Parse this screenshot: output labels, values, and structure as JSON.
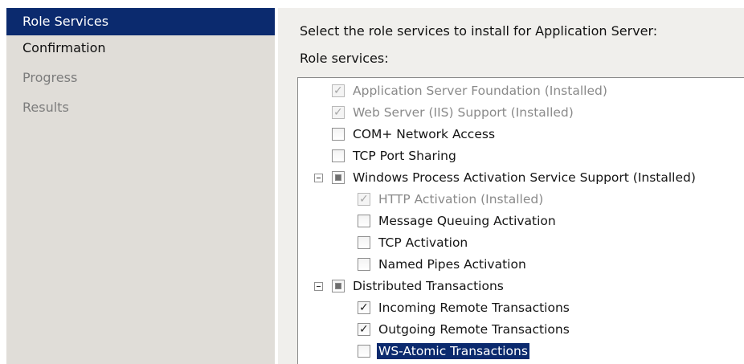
{
  "sidebar": {
    "steps": [
      {
        "label": "Role Services",
        "state": "active"
      },
      {
        "label": "Confirmation",
        "state": "normal"
      },
      {
        "label": "Progress",
        "state": "pending"
      },
      {
        "label": "Results",
        "state": "pending"
      }
    ]
  },
  "main": {
    "instruction": "Select the role services to install for Application Server:",
    "list_label": "Role services:"
  },
  "tree": {
    "items": [
      {
        "label": "Application Server Foundation  (Installed)",
        "checked": true,
        "disabled": true,
        "expander": false
      },
      {
        "label": "Web Server (IIS) Support  (Installed)",
        "checked": true,
        "disabled": true,
        "expander": false
      },
      {
        "label": "COM+ Network Access",
        "checked": false,
        "disabled": false,
        "expander": false
      },
      {
        "label": "TCP Port Sharing",
        "checked": false,
        "disabled": false,
        "expander": false
      },
      {
        "label": "Windows Process Activation Service Support  (Installed)",
        "checked": "indeterminate",
        "disabled": false,
        "expander": true
      },
      {
        "label": "HTTP Activation  (Installed)",
        "checked": true,
        "disabled": true,
        "expander": false
      },
      {
        "label": "Message Queuing Activation",
        "checked": false,
        "disabled": false,
        "expander": false
      },
      {
        "label": "TCP Activation",
        "checked": false,
        "disabled": false,
        "expander": false
      },
      {
        "label": "Named Pipes Activation",
        "checked": false,
        "disabled": false,
        "expander": false
      },
      {
        "label": "Distributed Transactions",
        "checked": "indeterminate",
        "disabled": false,
        "expander": true
      },
      {
        "label": "Incoming Remote Transactions",
        "checked": true,
        "disabled": false,
        "expander": false
      },
      {
        "label": "Outgoing Remote Transactions",
        "checked": true,
        "disabled": false,
        "expander": false
      },
      {
        "label": "WS-Atomic Transactions",
        "checked": false,
        "disabled": false,
        "expander": false,
        "selected": true
      }
    ]
  },
  "colors": {
    "selection": "#0b2a6e",
    "sidebar_bg": "#e0ddd8",
    "panel_bg": "#f0efec"
  },
  "icons": {
    "checkmark": "✓",
    "collapse": "collapse-icon"
  }
}
